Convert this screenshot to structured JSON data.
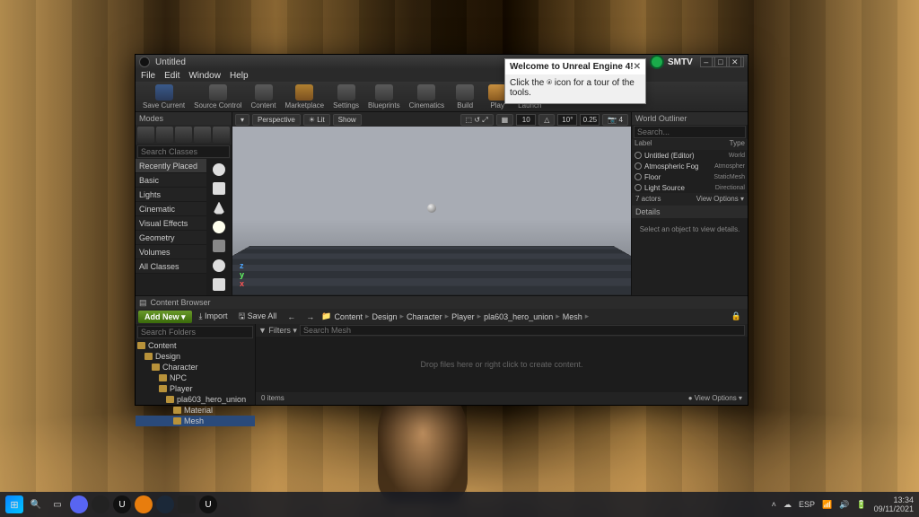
{
  "window": {
    "title": "Untitled",
    "menus": [
      "File",
      "Edit",
      "Window",
      "Help"
    ],
    "win_buttons": {
      "min": "–",
      "max": "□",
      "close": "✕"
    }
  },
  "toolbar": [
    {
      "id": "save",
      "label": "Save Current"
    },
    {
      "id": "source",
      "label": "Source Control"
    },
    {
      "id": "content",
      "label": "Content"
    },
    {
      "id": "market",
      "label": "Marketplace"
    },
    {
      "id": "settings",
      "label": "Settings"
    },
    {
      "id": "blueprints",
      "label": "Blueprints"
    },
    {
      "id": "cinematics",
      "label": "Cinematics"
    },
    {
      "id": "build",
      "label": "Build"
    },
    {
      "id": "play",
      "label": "Play"
    },
    {
      "id": "launch",
      "label": "Launch"
    }
  ],
  "modes": {
    "header": "Modes",
    "search_placeholder": "Search Classes",
    "categories": [
      "Recently Placed",
      "Basic",
      "Lights",
      "Cinematic",
      "Visual Effects",
      "Geometry",
      "Volumes",
      "All Classes"
    ]
  },
  "viewport": {
    "perspective": "Perspective",
    "lit": "Lit",
    "show": "Show",
    "snap1": "10",
    "snap2": "10°",
    "snap3": "0.25",
    "axes": {
      "x": "x",
      "y": "y",
      "z": "z"
    }
  },
  "outliner": {
    "header": "World Outliner",
    "cols": {
      "label": "Label",
      "type": "Type"
    },
    "rows": [
      {
        "label": "Untitled (Editor)",
        "type": "World"
      },
      {
        "label": "Atmospheric Fog",
        "type": "Atmospher"
      },
      {
        "label": "Floor",
        "type": "StaticMesh"
      },
      {
        "label": "Light Source",
        "type": "Directional"
      }
    ],
    "count": "7 actors",
    "view_options": "View Options ▾"
  },
  "details": {
    "header": "Details",
    "empty": "Select an object to view details."
  },
  "content_browser": {
    "header": "Content Browser",
    "add_new": "Add New ▾",
    "import": "⤓ Import",
    "save_all": "🖫 Save All",
    "nav_back": "←",
    "nav_fwd": "→",
    "breadcrumb": [
      "Content",
      "Design",
      "Character",
      "Player",
      "pla603_hero_union",
      "Mesh"
    ],
    "tree_search": "Search Folders",
    "tree": [
      {
        "d": 0,
        "label": "Content"
      },
      {
        "d": 1,
        "label": "Design"
      },
      {
        "d": 2,
        "label": "Character"
      },
      {
        "d": 3,
        "label": "NPC"
      },
      {
        "d": 3,
        "label": "Player"
      },
      {
        "d": 4,
        "label": "pla603_hero_union"
      },
      {
        "d": 5,
        "label": "Material"
      },
      {
        "d": 5,
        "label": "Mesh",
        "sel": true
      }
    ],
    "filters": "▼ Filters ▾",
    "asset_search": "Search Mesh",
    "drop_hint": "Drop files here or right click to create content.",
    "status_items": "0 items",
    "view_options": "● View Options ▾"
  },
  "popup": {
    "title": "Welcome to Unreal Engine 4!",
    "body": "Click the ⍟ icon for a tour of the tools.",
    "close": "✕"
  },
  "game_overlay": {
    "label": "SMTV"
  },
  "taskbar": {
    "tray": {
      "lang": "ESP",
      "time": "13:34",
      "date": "09/11/2021"
    }
  }
}
